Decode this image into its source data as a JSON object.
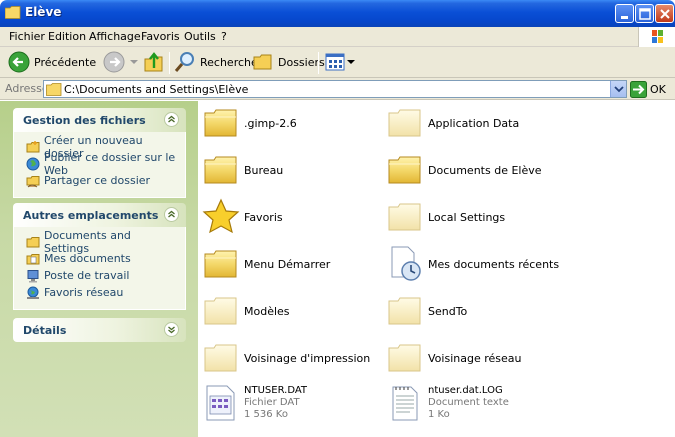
{
  "window": {
    "title": "Elève"
  },
  "menu": [
    "Fichier",
    "Edition",
    "Affichage",
    "Favoris",
    "Outils",
    "?"
  ],
  "toolbar": {
    "back": "Précédente",
    "search": "Rechercher",
    "folders": "Dossiers"
  },
  "address": {
    "label": "Adresse",
    "value": "C:\\Documents and Settings\\Elève",
    "go": "OK"
  },
  "tasks": {
    "file_tasks": {
      "title": "Gestion des fichiers",
      "items": [
        "Créer un nouveau dossier",
        "Publier ce dossier sur le Web",
        "Partager ce dossier"
      ]
    },
    "other_places": {
      "title": "Autres emplacements",
      "items": [
        "Documents and Settings",
        "Mes documents",
        "Poste de travail",
        "Favoris réseau"
      ]
    },
    "details": {
      "title": "Détails"
    }
  },
  "files": [
    {
      "name": ".gimp-2.6",
      "icon": "folder-icon"
    },
    {
      "name": "Application Data",
      "icon": "folder-faded-icon"
    },
    {
      "name": "Bureau",
      "icon": "folder-icon"
    },
    {
      "name": "Documents de Elève",
      "icon": "folder-icon"
    },
    {
      "name": "Favoris",
      "icon": "star-icon"
    },
    {
      "name": "Local Settings",
      "icon": "folder-faded-icon"
    },
    {
      "name": "Menu Démarrer",
      "icon": "folder-icon"
    },
    {
      "name": "Mes documents récents",
      "icon": "recent-docs-icon"
    },
    {
      "name": "Modèles",
      "icon": "folder-faded-icon"
    },
    {
      "name": "SendTo",
      "icon": "folder-faded-icon"
    },
    {
      "name": "Voisinage d'impression",
      "icon": "folder-faded-icon"
    },
    {
      "name": "Voisinage réseau",
      "icon": "folder-faded-icon"
    },
    {
      "name": "NTUSER.DAT",
      "type": "Fichier DAT",
      "size": "1 536 Ko",
      "icon": "dat-file-icon"
    },
    {
      "name": "ntuser.dat.LOG",
      "type": "Document texte",
      "size": "1 Ko",
      "icon": "text-file-icon"
    }
  ]
}
